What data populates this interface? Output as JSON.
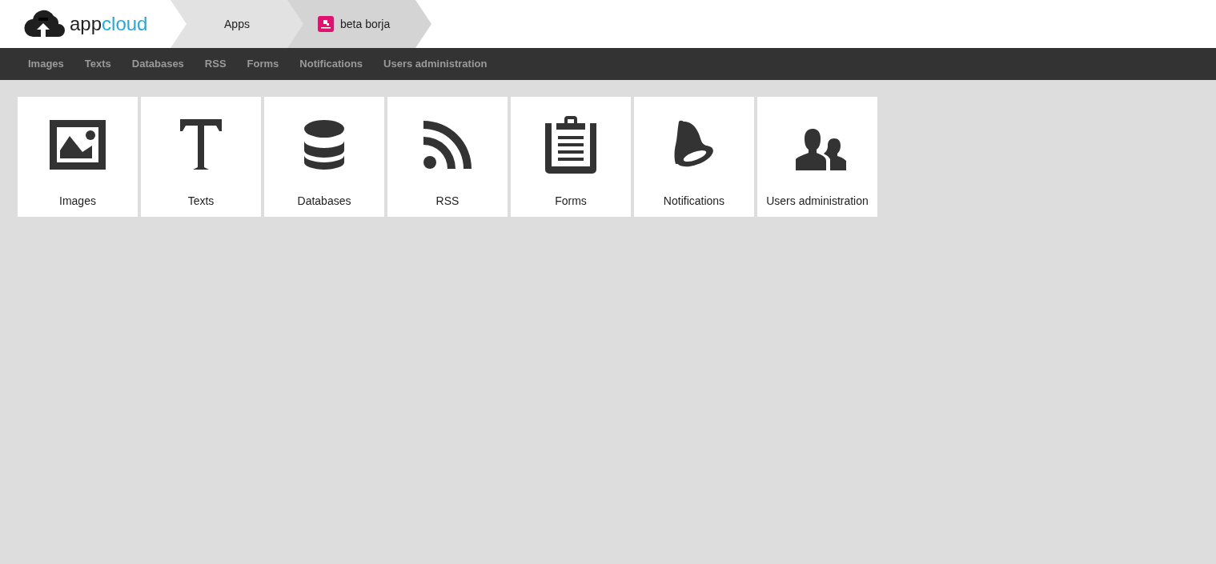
{
  "logo": {
    "text_dark": "app",
    "text_accent": "cloud"
  },
  "breadcrumbs": [
    {
      "label": "Apps",
      "kind": "plain"
    },
    {
      "label": "beta borja",
      "kind": "app"
    }
  ],
  "menu": [
    "Images",
    "Texts",
    "Databases",
    "RSS",
    "Forms",
    "Notifications",
    "Users administration"
  ],
  "tiles": [
    {
      "label": "Images",
      "kind": "image"
    },
    {
      "label": "Texts",
      "kind": "text"
    },
    {
      "label": "Databases",
      "kind": "database"
    },
    {
      "label": "RSS",
      "kind": "rss"
    },
    {
      "label": "Forms",
      "kind": "form"
    },
    {
      "label": "Notifications",
      "kind": "bell"
    },
    {
      "label": "Users administration",
      "kind": "users"
    }
  ]
}
